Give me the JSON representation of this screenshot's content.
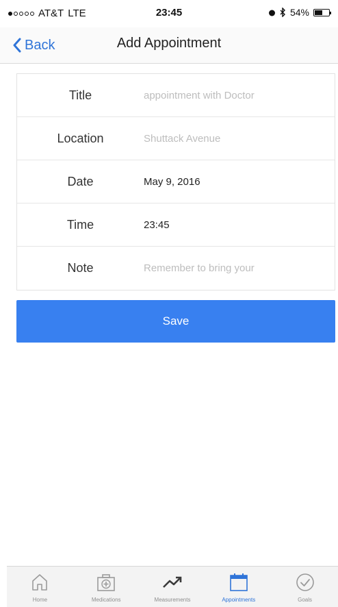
{
  "status_bar": {
    "carrier": "AT&T",
    "network": "LTE",
    "time": "23:45",
    "battery_text": "54%",
    "battery_level": 0.54
  },
  "nav": {
    "back_label": "Back",
    "title": "Add Appointment"
  },
  "form": {
    "fields": [
      {
        "label": "Title",
        "value": "",
        "placeholder": "appointment with Doctor"
      },
      {
        "label": "Location",
        "value": "",
        "placeholder": "Shuttack Avenue"
      },
      {
        "label": "Date",
        "value": "May 9, 2016",
        "placeholder": ""
      },
      {
        "label": "Time",
        "value": "23:45",
        "placeholder": ""
      },
      {
        "label": "Note",
        "value": "",
        "placeholder": "Remember to bring your"
      }
    ]
  },
  "save_label": "Save",
  "tabs": [
    {
      "label": "Home",
      "icon": "home-icon",
      "active": false
    },
    {
      "label": "Medications",
      "icon": "medical-kit-icon",
      "active": false
    },
    {
      "label": "Measurements",
      "icon": "trend-up-icon",
      "active": false
    },
    {
      "label": "Appointments",
      "icon": "calendar-icon",
      "active": true
    },
    {
      "label": "Goals",
      "icon": "checkmark-circle-icon",
      "active": false
    }
  ],
  "colors": {
    "accent": "#2f74d8",
    "save_button": "#3880f0",
    "placeholder": "#bdbdbd"
  }
}
